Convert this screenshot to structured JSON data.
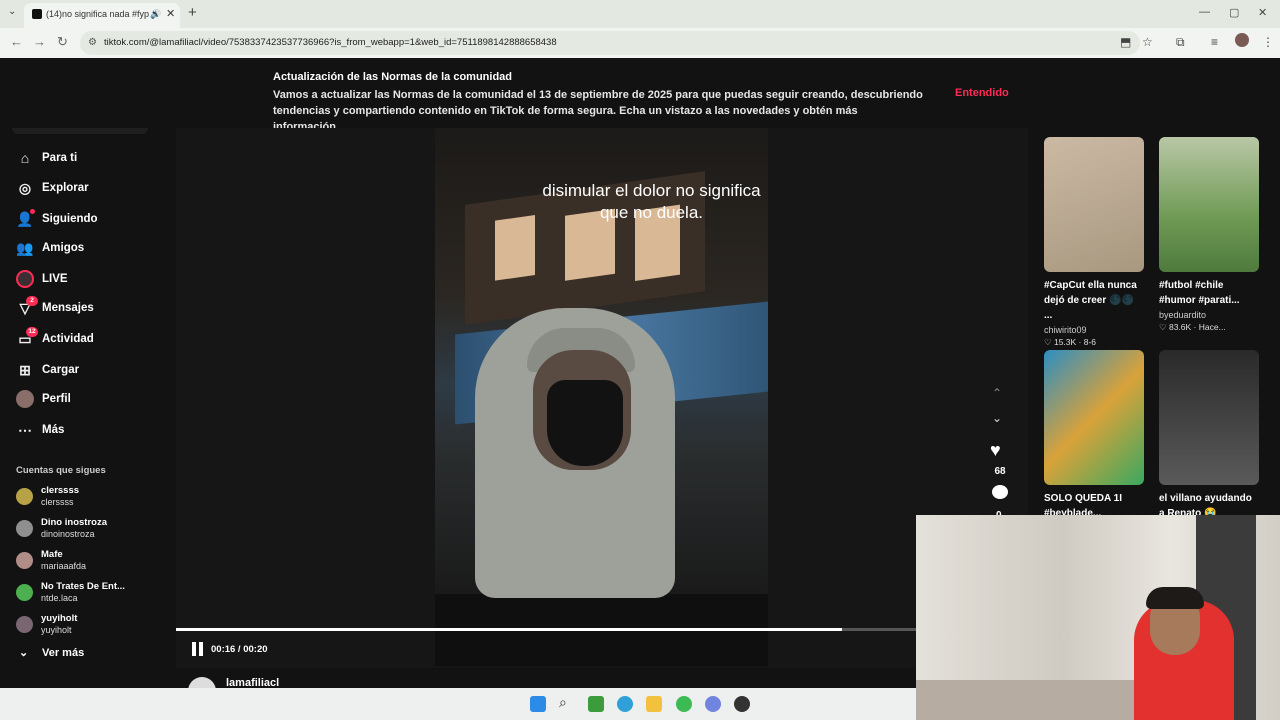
{
  "browser": {
    "tab_title": "(14)no significa nada #fyp #",
    "url": "tiktok.com/@lamafiliacl/video/7538337423537736966?is_from_webapp=1&web_id=7511898142888658438"
  },
  "banner": {
    "title": "Actualización de las Normas de la comunidad",
    "body": "Vamos a actualizar las Normas de la comunidad el 13 de septiembre de 2025 para que puedas seguir creando, descubriendo tendencias y compartiendo contenido en TikTok de forma segura. Echa un vistazo a las novedades y obtén más información.",
    "action": "Entendido"
  },
  "sidebar": {
    "items": [
      {
        "label": "Para ti"
      },
      {
        "label": "Explorar"
      },
      {
        "label": "Siguiendo"
      },
      {
        "label": "Amigos"
      },
      {
        "label": "LIVE"
      },
      {
        "label": "Mensajes",
        "badge": "2"
      },
      {
        "label": "Actividad",
        "badge": "12"
      },
      {
        "label": "Cargar"
      },
      {
        "label": "Perfil"
      },
      {
        "label": "Más"
      }
    ],
    "following_title": "Cuentas que sigues",
    "following": [
      {
        "name": "clerssss",
        "handle": "clerssss",
        "color": "#b8a246"
      },
      {
        "name": "Dino inostroza",
        "handle": "dinoinostroza",
        "color": "#8f8f8f"
      },
      {
        "name": "Mafe",
        "handle": "mariaaafda",
        "color": "#b08d86"
      },
      {
        "name": "No Trates De Ent...",
        "handle": "ntde.laca",
        "color": "#4caf50"
      },
      {
        "name": "yuyiholt",
        "handle": "yuyiholt",
        "color": "#7a6670"
      }
    ],
    "see_more": "Ver más"
  },
  "video": {
    "caption": "disimular el dolor no significa que no duela.",
    "time": "00:16 / 00:20",
    "progress": 0.9,
    "likes": "68",
    "comments": "0",
    "author": "lamafiliacl"
  },
  "related": [
    {
      "title": "#CapCut ella nunca dejó de creer 🌑🌑 ...",
      "author": "chiwirito09",
      "stats": "♡ 15.3K · 8-6",
      "color": "#b7a690"
    },
    {
      "title": "#futbol #chile #humor #parati...",
      "author": "byeduardito",
      "stats": "♡ 83.6K · Hace...",
      "color": "#6f9a55"
    },
    {
      "title": "SOLO QUEDA 1I #beyblade...",
      "author": "",
      "stats": "",
      "color": "#2d8ec2"
    },
    {
      "title": "el villano ayudando a Renato 😭",
      "author": "",
      "stats": "",
      "color": "#3a3a3a"
    }
  ]
}
